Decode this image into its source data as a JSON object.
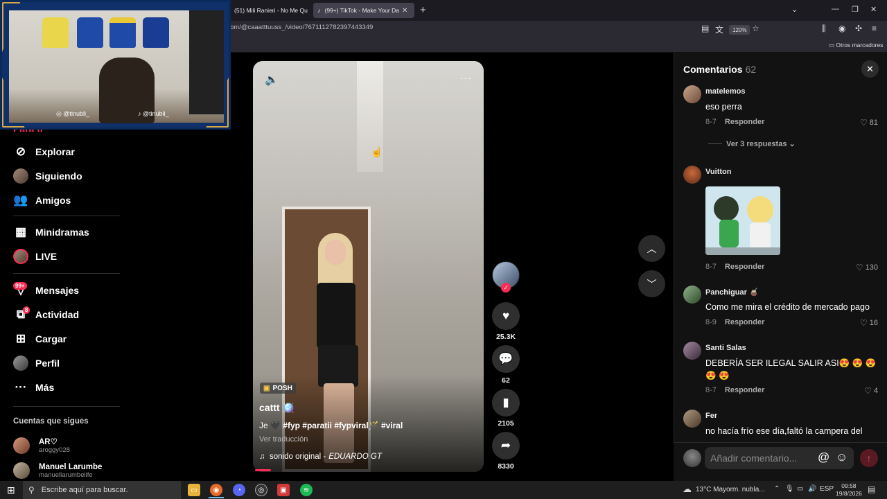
{
  "browser": {
    "tabs": [
      {
        "label": "(51) Mili Ranieri - No Me Qu"
      },
      {
        "label": "(99+) TikTok - Make Your Da",
        "favicon": "tiktok-icon"
      }
    ],
    "url": "om/@caaatttuuss_/video/7671112782397443349",
    "zoom": "120%",
    "bookmarks_label": "Otros marcadores"
  },
  "webcam": {
    "handle_left": "@tinubli_",
    "handle_right": "@tinubli_"
  },
  "sidebar": {
    "partial_item": "Para ti",
    "items": [
      {
        "label": "Explorar",
        "icon": "compass-icon"
      },
      {
        "label": "Siguiendo",
        "icon": "avatar"
      },
      {
        "label": "Amigos",
        "icon": "friends-icon"
      },
      {
        "label": "Minidramas",
        "icon": "film-icon"
      },
      {
        "label": "LIVE",
        "icon": "live-avatar"
      },
      {
        "label": "Mensajes",
        "icon": "messages-icon",
        "badge": "99+"
      },
      {
        "label": "Actividad",
        "icon": "activity-icon",
        "badge": "8"
      },
      {
        "label": "Cargar",
        "icon": "upload-icon"
      },
      {
        "label": "Perfil",
        "icon": "profile-avatar"
      },
      {
        "label": "Más",
        "icon": "more-icon"
      }
    ],
    "following_title": "Cuentas que sigues",
    "accounts": [
      {
        "name": "AR♡",
        "handle": "aroggy028"
      },
      {
        "name": "Manuel Larumbe",
        "handle": "manuellarumbelife"
      }
    ]
  },
  "video": {
    "tag": "POSH",
    "username": "cattt 🪩",
    "caption_prefix": "Je 🖤",
    "hashtags": "#fyp #paratii #fypviral🪄 #viral",
    "translate": "Ver traducción",
    "sound": "sonido original -",
    "sound_artist": "EDUARDO GT",
    "progress": 0.07
  },
  "actions": {
    "likes": "25.3K",
    "comments": "62",
    "saves": "2105",
    "shares": "8330"
  },
  "comments_panel": {
    "title": "Comentarios",
    "count": "62",
    "view_replies": "Ver 3 respuestas",
    "reply_label": "Responder",
    "input_placeholder": "Añadir comentario...",
    "comments": [
      {
        "user": "matelemos",
        "text": "eso perra",
        "date": "8-7",
        "likes": "81"
      },
      {
        "user": "Vuitton",
        "text": "",
        "date": "8-7",
        "likes": "130"
      },
      {
        "user": "Panchiguar 🧉",
        "text": "Como me mira el crédito de mercado pago",
        "date": "8-9",
        "likes": "16"
      },
      {
        "user": "Santi Salas",
        "text": "DEBERÍA SER ILEGAL SALIR ASI😍 😍 😍 😍 😍",
        "date": "8-7",
        "likes": "4"
      },
      {
        "user": "Fer",
        "text": "no hacía frío ese día,faltó la campera del",
        "date": "",
        "likes": ""
      }
    ]
  },
  "taskbar": {
    "search_placeholder": "Escribe aquí para buscar.",
    "weather": "13°C  Mayorm. nubla...",
    "lang": "ESP",
    "time": "09:58",
    "date": "19/8/2026"
  },
  "colors": {
    "accent": "#fe2c55",
    "panel_bg": "#121212",
    "browser_tab_active": "#42414d"
  }
}
